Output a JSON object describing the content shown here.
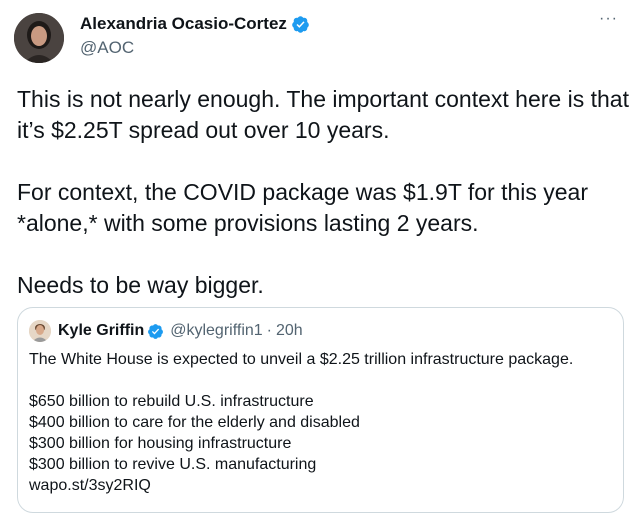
{
  "author": {
    "name": "Alexandria Ocasio-Cortez",
    "handle": "@AOC"
  },
  "more_label": "···",
  "tweet": {
    "paragraphs": [
      "This is not nearly enough. The important context here is that it’s $2.25T spread out over 10 years.",
      "For context, the COVID package was $1.9T for this year *alone,* with some provisions lasting 2 years.",
      "Needs to be way bigger."
    ]
  },
  "quote": {
    "name": "Kyle Griffin",
    "handle": "@kylegriffin1",
    "separator": "·",
    "time": "20h",
    "headline": "The White House is expected to unveil a $2.25 trillion infrastructure package.",
    "lines": [
      "$650 billion to rebuild U.S. infrastructure",
      "$400 billion to care for the elderly and disabled",
      "$300 billion for housing infrastructure",
      "$300 billion to revive U.S. manufacturing",
      "wapo.st/3sy2RIQ"
    ]
  },
  "colors": {
    "verified": "#1d9bf0",
    "secondary_text": "#536471",
    "border": "#cfd9de"
  },
  "icons": [
    "verified-badge-icon",
    "more-options-icon"
  ]
}
